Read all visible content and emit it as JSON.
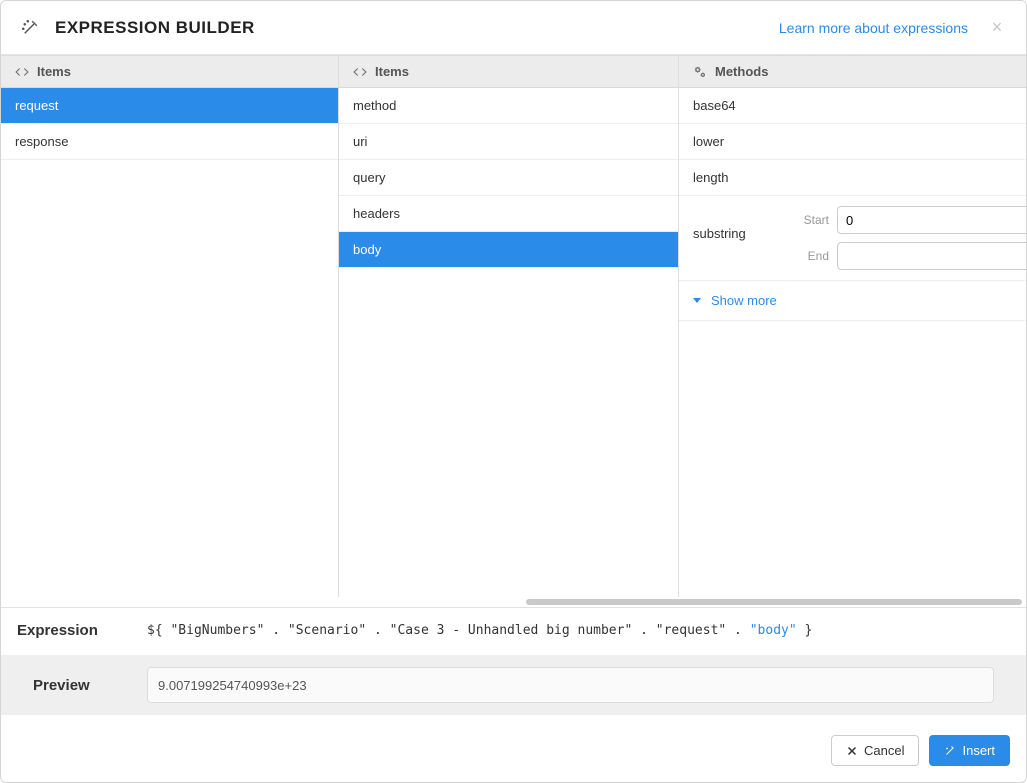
{
  "header": {
    "title": "EXPRESSION BUILDER",
    "learn_more": "Learn more about expressions"
  },
  "columns": {
    "col1": {
      "header": "Items",
      "items": [
        "request",
        "response"
      ],
      "selected_index": 0
    },
    "col2": {
      "header": "Items",
      "items": [
        "method",
        "uri",
        "query",
        "headers",
        "body"
      ],
      "selected_index": 4
    },
    "col3": {
      "header": "Methods",
      "methods_simple": [
        "base64",
        "lower",
        "length"
      ],
      "substring_label": "substring",
      "substring_params": {
        "start_label": "Start",
        "start_value": "0",
        "end_label": "End",
        "end_value": ""
      },
      "show_more": "Show more"
    }
  },
  "bottom": {
    "expression_label": "Expression",
    "expr_parts": {
      "open": "${",
      "p1": "\"BigNumbers\"",
      "p2": "\"Scenario\"",
      "p3": "\"Case 3 - Unhandled big number\"",
      "p4": "\"request\"",
      "p5": "\"body\"",
      "close": "}"
    },
    "preview_label": "Preview",
    "preview_value": "9.007199254740993e+23",
    "cancel": "Cancel",
    "insert": "Insert"
  }
}
